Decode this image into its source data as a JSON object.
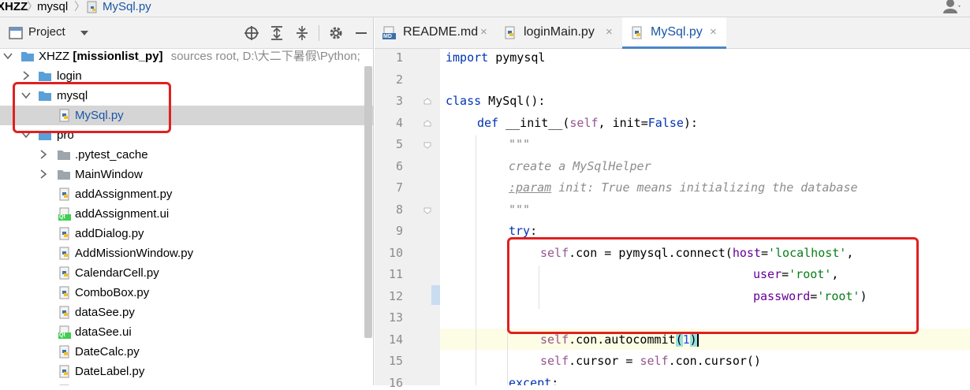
{
  "breadcrumb": {
    "project": "XHZZ",
    "folder": "mysql",
    "file": "MySql.py"
  },
  "project_panel": {
    "title": "Project",
    "root": {
      "name": "XHZZ",
      "module": "[missionlist_py]",
      "info": "sources root,  D:\\大二下暑假\\Python;"
    },
    "items": [
      {
        "label": "login"
      },
      {
        "label": "mysql"
      },
      {
        "label": "MySql.py"
      },
      {
        "label": "pro"
      },
      {
        "label": ".pytest_cache"
      },
      {
        "label": "MainWindow"
      },
      {
        "label": "addAssignment.py"
      },
      {
        "label": "addAssignment.ui"
      },
      {
        "label": "addDialog.py"
      },
      {
        "label": "AddMissionWindow.py"
      },
      {
        "label": "CalendarCell.py"
      },
      {
        "label": "ComboBox.py"
      },
      {
        "label": "dataSee.py"
      },
      {
        "label": "dataSee.ui"
      },
      {
        "label": "DateCalc.py"
      },
      {
        "label": "DateLabel.py"
      }
    ],
    "qt_badge": "Qt"
  },
  "editor": {
    "tabs": [
      {
        "label": "README.md",
        "badge": "MD"
      },
      {
        "label": "loginMain.py"
      },
      {
        "label": "MySql.py"
      }
    ],
    "close_glyph": "×",
    "line_numbers": [
      "1",
      "2",
      "3",
      "4",
      "5",
      "6",
      "7",
      "8",
      "9",
      "10",
      "11",
      "12",
      "13",
      "14",
      "15",
      "16"
    ],
    "code": {
      "l1": {
        "kw": "import",
        "rest": " pymysql"
      },
      "l3": {
        "kw": "class",
        "rest": " MySql():"
      },
      "l4": {
        "kw": "def",
        "fn": " __init__(",
        "self": "self",
        "mid": ", init=",
        "false": "False",
        "end": "):"
      },
      "l5": "\"\"\"",
      "l6": "create a MySqlHelper",
      "l7": {
        "tag": ":param",
        "rest": " init: True means initializing the database"
      },
      "l8": "\"\"\"",
      "l9": {
        "kw": "try",
        "rest": ":"
      },
      "l10": {
        "self": "self",
        "a": ".con = pymysql.connect(",
        "p": "host",
        "eq": "=",
        "s": "'localhost'",
        "end": ","
      },
      "l11": {
        "p": "user",
        "eq": "=",
        "s": "'root'",
        "end": ","
      },
      "l12": {
        "p": "password",
        "eq": "=",
        "s": "'root'",
        "end": ")"
      },
      "l14": {
        "self": "self",
        "a": ".con.autocommit",
        "lp": "(",
        "n": "1",
        "rp": ")"
      },
      "l15": {
        "self1": "self",
        "a": ".cursor = ",
        "self2": "self",
        "b": ".con.cursor()"
      },
      "l16": {
        "kw": "except",
        "rest": ":"
      }
    }
  },
  "colors": {
    "highlight": "#e02020",
    "keyword": "#0033b3",
    "string": "#067d17",
    "self": "#94558d"
  }
}
